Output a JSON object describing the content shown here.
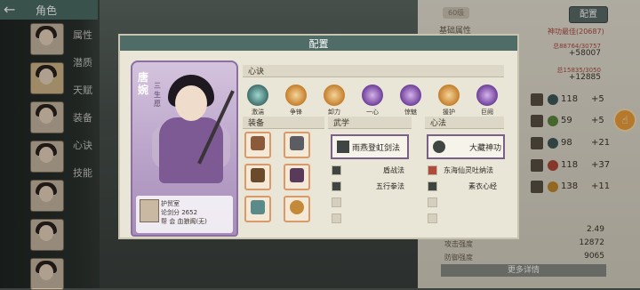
{
  "top": {
    "back": "←",
    "title": "角色"
  },
  "sidebar": {
    "tabs": [
      "属性",
      "潜质",
      "天赋",
      "装备",
      "心诀",
      "技能"
    ]
  },
  "right_panel": {
    "level_badge": "60级",
    "config_button": "配置",
    "section_label": "基础属性",
    "power_label": "神功最佳(20687)",
    "stat_lines": [
      {
        "small": "总88764/30757",
        "big": "+58007"
      },
      {
        "small": "总15835/3050",
        "big": "+12885"
      }
    ],
    "mini_rows": [
      {
        "value": "118",
        "bonus": "+5"
      },
      {
        "value": "59",
        "bonus": "+5"
      },
      {
        "value": "98",
        "bonus": "+21"
      },
      {
        "value": "118",
        "bonus": "+37"
      },
      {
        "value": "138",
        "bonus": "+11"
      }
    ],
    "bottom_stats": [
      {
        "label": "",
        "value": "2.49"
      },
      {
        "label": "攻击强度",
        "value": "12872"
      },
      {
        "label": "防御强度",
        "value": "9065"
      }
    ],
    "more_button": "更多详情"
  },
  "dialog": {
    "title": "配置",
    "character": {
      "name": "唐婉",
      "subtitle": "三生愿",
      "info": {
        "line1": "护贸室",
        "line2": "论剑分 2652",
        "line3": "帮 会 血狼阁(无)"
      }
    },
    "xinjue": {
      "header": "心诀",
      "skills": [
        "激湍",
        "争锋",
        "卸力",
        "一心",
        "惊魅",
        "援护",
        "巨阙"
      ]
    },
    "equip": {
      "header": "装备",
      "items": [
        "",
        "",
        "",
        "",
        "",
        ""
      ]
    },
    "wuxue": {
      "header": "武学",
      "main": "雨燕登虹剑法",
      "list": [
        "盾战法",
        "五行拳法"
      ]
    },
    "xinfa": {
      "header": "心法",
      "main": "大藏神功",
      "list": [
        "东海仙灵吐纳法",
        "素衣心经"
      ]
    }
  },
  "colors": {
    "accent": "#4f6c67",
    "purple": "#7a5f86",
    "orange": "#f2a23c"
  }
}
